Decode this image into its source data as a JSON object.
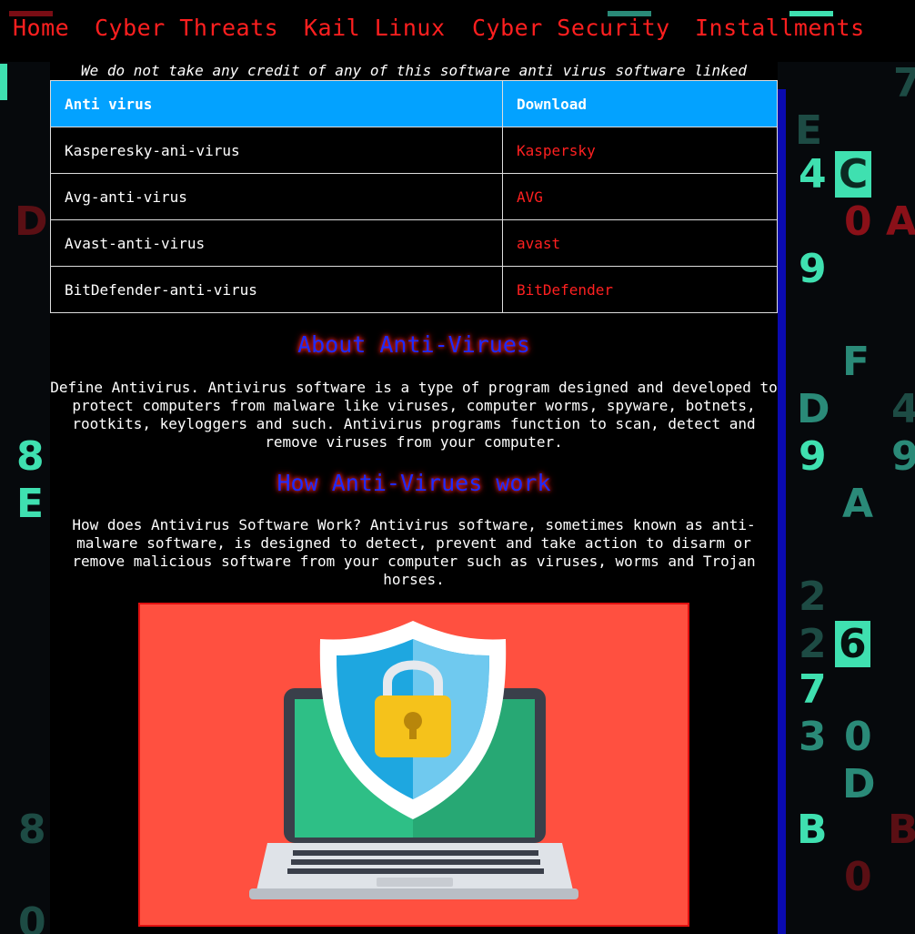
{
  "nav": {
    "items": [
      "Home",
      "Cyber Threats",
      "Kail Linux",
      "Cyber Security",
      "Installments"
    ]
  },
  "credit_note": "We do not take any credit of any of this software anti virus software linked",
  "table": {
    "headers": [
      "Anti virus",
      "Download"
    ],
    "rows": [
      {
        "name": "Kasperesky-ani-virus",
        "link": "Kaspersky"
      },
      {
        "name": "Avg-anti-virus",
        "link": "AVG"
      },
      {
        "name": "Avast-anti-virus",
        "link": "avast"
      },
      {
        "name": "BitDefender-anti-virus",
        "link": "BitDefender"
      }
    ]
  },
  "about": {
    "heading": "About Anti-Virues",
    "text": "Define Antivirus. Antivirus software is a type of program designed and developed to protect computers from malware like viruses, computer worms, spyware, botnets, rootkits, keyloggers and such. Antivirus programs function to scan, detect and remove viruses from your computer."
  },
  "how": {
    "heading": "How Anti-Virues work",
    "text": "How does Antivirus Software Work? Antivirus software, sometimes known as anti-malware software, is designed to detect, prevent and take action to disarm or remove malicious software from your computer such as viruses, worms and Trojan horses."
  },
  "hero_image": {
    "icon": "laptop-shield-lock-icon"
  },
  "background_glyphs": [
    "7",
    "E",
    "4",
    "C",
    "0",
    "A",
    "D",
    "9",
    "F",
    "D",
    "4",
    "9",
    "9",
    "A",
    "8",
    "E",
    "2",
    "6",
    "2",
    "7",
    "3",
    "0",
    "D",
    "B",
    "B",
    "8",
    "0",
    "0"
  ],
  "colors": {
    "nav_link": "#ff1f1f",
    "table_header": "#03a2ff",
    "heading": "#1c2cff",
    "download_link": "#ff2020",
    "hero_bg": "#ff5040"
  }
}
